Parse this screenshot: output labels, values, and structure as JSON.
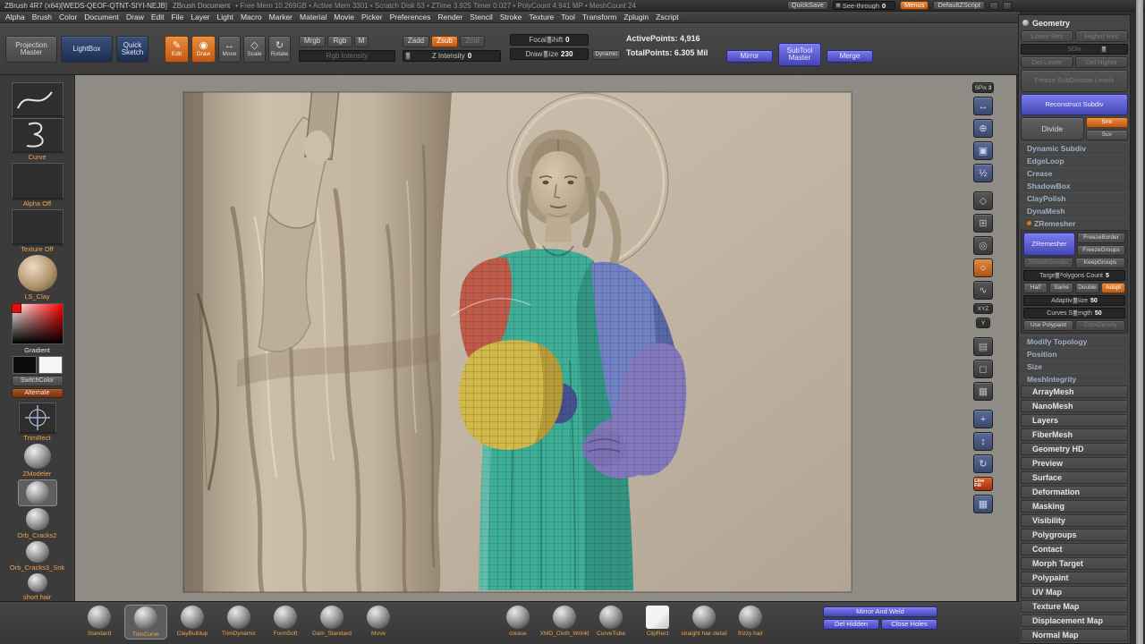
{
  "colors": {
    "accent_orange": "#d4702a",
    "accent_blue": "#5557cc",
    "label_orange": "#f0a24e",
    "canvas_background": "#8f8b85",
    "document_tan": "#c2b5a3",
    "polygroup_teal": "#3fae97",
    "polygroup_red": "#bf5a49",
    "polygroup_blue": "#7080c2",
    "polygroup_purple": "#8478bd",
    "polygroup_yellow": "#d2b749"
  },
  "icons": {
    "edit": "✎",
    "draw": "◉",
    "move": "↔",
    "scale": "◇",
    "rotate": "↻",
    "scroll": "↔",
    "zoom": "⊕",
    "actual": "▣",
    "aahalf": "½",
    "persp": "◇",
    "floor": "⊞",
    "local": "◎",
    "lasso": "○",
    "lsym": "∿",
    "transp": "▤",
    "ghost": "◻",
    "frame": "▦",
    "move3d": "+",
    "scale3d": "↕",
    "rotate3d": "↻",
    "polyf": "▦"
  },
  "title_bar": {
    "app_title": "ZBrush 4R7 (x64)[WEDS-QEOF-QTNT-SIYI-NEJB]",
    "doc_title": "ZBrush Document",
    "stats": "• Free Mem 10.269GB • Active Mem 3301 • Scratch Disk 53 • ZTime 3.925 Timer 0.027 • PolyCount 4.941 MP • MeshCount 24",
    "quicksave": "QuickSave",
    "see_through": "See-through",
    "see_through_value": "0",
    "menus": "Menus",
    "default_zscript": "DefaultZScript"
  },
  "menu_bar": {
    "items": [
      "Alpha",
      "Brush",
      "Color",
      "Document",
      "Draw",
      "Edit",
      "File",
      "Layer",
      "Light",
      "Macro",
      "Marker",
      "Material",
      "Movie",
      "Picker",
      "Preferences",
      "Render",
      "Stencil",
      "Stroke",
      "Texture",
      "Tool",
      "Transform",
      "Zplugin",
      "Zscript"
    ]
  },
  "toolbar": {
    "projection_master": "Projection Master",
    "lightbox": "LightBox",
    "quick_sketch": "Quick Sketch",
    "edit": "Edit",
    "draw": "Draw",
    "move": "Move",
    "scale": "Scale",
    "rotate": "Rotate",
    "mrgb": "Mrgb",
    "rgb": "Rgb",
    "m": "M",
    "rgb_intensity": "Rgb Intensity",
    "zadd": "Zadd",
    "zsub": "Zsub",
    "zcut": "Zcut",
    "z_intensity": "Z Intensity",
    "z_intensity_value": "0",
    "focal_shift": "Focal Shift",
    "focal_shift_value": "0",
    "draw_size": "Draw Size",
    "draw_size_value": "230",
    "dynamic": "Dynamic",
    "active_points": "ActivePoints: 4,916",
    "total_points": "TotalPoints: 6.305 Mil",
    "mirror": "Mirror",
    "subtool_master": "SubTool Master",
    "merge": "Merge"
  },
  "left_palette": {
    "curve_label": "Curve",
    "alpha_label": "Alpha Off",
    "texture_label": "Texture Off",
    "material_label": "LS_Clay",
    "gradient_label": "Gradient",
    "switch_color": "SwitchColor",
    "alternate": "Alternate",
    "trimrect": "TrimRect",
    "zmodeler": "ZModeler",
    "orb_cracks2": "Orb_Cracks2",
    "orb_cracks3": "Orb_Cracks3_Snk",
    "short_hair": "short hair"
  },
  "right_shelf": {
    "spix": "SPix",
    "spix_value": "3",
    "xyz": "XYZ",
    "y": "Y",
    "line_fill": "Line Fill"
  },
  "right_panel": {
    "header": "Geometry",
    "lower_res": "Lower Res",
    "higher_res": "Higher Res",
    "sdiv": "SDiv",
    "del_lower": "Del Lower",
    "del_higher": "Del Higher",
    "freeze_sub": "Freeze SubDivision Levels",
    "reconstruct": "Reconstruct Subdiv",
    "divide": "Divide",
    "smt": "Smt",
    "suv": "Suv",
    "dynamic_subdiv": "Dynamic Subdiv",
    "edgeloop": "EdgeLoop",
    "crease": "Crease",
    "shadowbox": "ShadowBox",
    "claypolish": "ClayPolish",
    "dynamesh": "DynaMesh",
    "zremesher": {
      "header": "ZRemesher",
      "button": "ZRemesher",
      "freeze_border": "FreezeBorder",
      "freeze_groups": "FreezeGroups",
      "smooth_groups": "SmoothGroups",
      "keep_groups": "KeepGroups",
      "target_label": "Target Polygons Count",
      "target_value": "5",
      "half": "Half",
      "same": "Same",
      "double": "Double",
      "adapt": "Adapt",
      "adaptive_label": "AdaptiveSize",
      "adaptive_value": "50",
      "curves_label": "Curves Strength",
      "curves_value": "50",
      "use_polypaint": "Use Polypaint",
      "color_density": "ColorDensity"
    },
    "modify_topology": "Modify Topology",
    "position": "Position",
    "size": "Size",
    "mesh_integrity": "MeshIntegrity",
    "palettes": [
      "ArrayMesh",
      "NanoMesh",
      "Layers",
      "FiberMesh",
      "Geometry HD",
      "Preview",
      "Surface",
      "Deformation",
      "Masking",
      "Visibility",
      "Polygroups",
      "Contact",
      "Morph Target",
      "Polypaint",
      "UV Map",
      "Texture Map",
      "Displacement Map",
      "Normal Map"
    ]
  },
  "bottom_bar": {
    "brushes": [
      "Standard",
      "TrimCurve",
      "ClayBuildup",
      "TrimDynamic",
      "FormSoft",
      "Dam_Standard",
      "Move",
      "crease",
      "XMD_Cloth_Wrinkl",
      "CurveTube",
      "ClipRect",
      "straight hair detail",
      "frizzy hair"
    ],
    "mirror_and_weld": "Mirror And Weld",
    "del_hidden": "Del Hidden",
    "close_holes": "Close Holes"
  }
}
